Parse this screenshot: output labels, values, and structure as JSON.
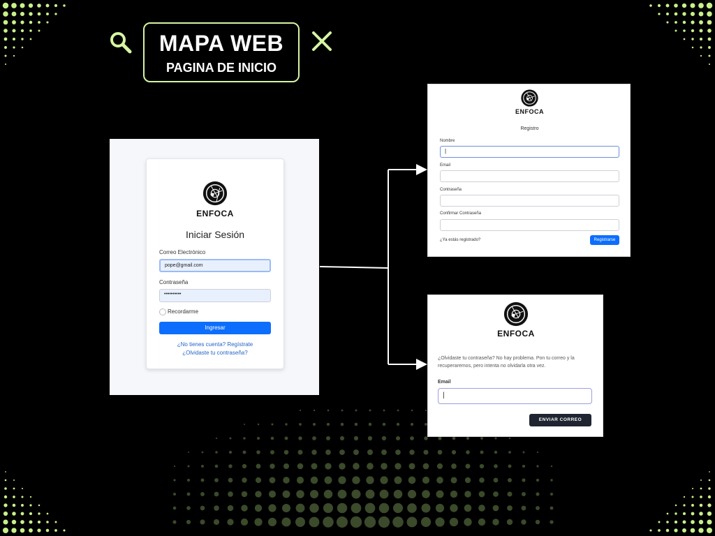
{
  "header": {
    "title": "MAPA WEB",
    "subtitle": "PAGINA DE INICIO"
  },
  "icons": {
    "left": "search-icon",
    "right": "close-icon"
  },
  "colors": {
    "accent": "#d6f5a3",
    "background": "#000000",
    "primary_button": "#0d6efd",
    "dark_button": "#1f2430"
  },
  "login": {
    "brand": "ENFOCA",
    "heading": "Iniciar Sesión",
    "email_label": "Correo Electrónico",
    "email_value": "pope@gmail.com",
    "password_label": "Contraseña",
    "password_value": "••••••••••",
    "remember_label": "Recordarme",
    "submit_label": "Ingresar",
    "register_link": "¿No tienes cuenta? Regístrate",
    "forgot_link": "¿Olvidaste tu contraseña?"
  },
  "register": {
    "brand": "ENFOCA",
    "heading": "Registro",
    "name_label": "Nombre",
    "email_label": "Email",
    "password_label": "Contraseña",
    "confirm_label": "Confirmar Contraseña",
    "already_link": "¿Ya estás registrado?",
    "submit_label": "Registrarse"
  },
  "forgot": {
    "brand": "ENFOCA",
    "message": "¿Olvidaste tu contraseña? No hay problema. Pon tu correo y la recuperaremos, pero intenta no olvidarla otra vez.",
    "email_label": "Email",
    "submit_label": "ENVIAR CORREO"
  }
}
